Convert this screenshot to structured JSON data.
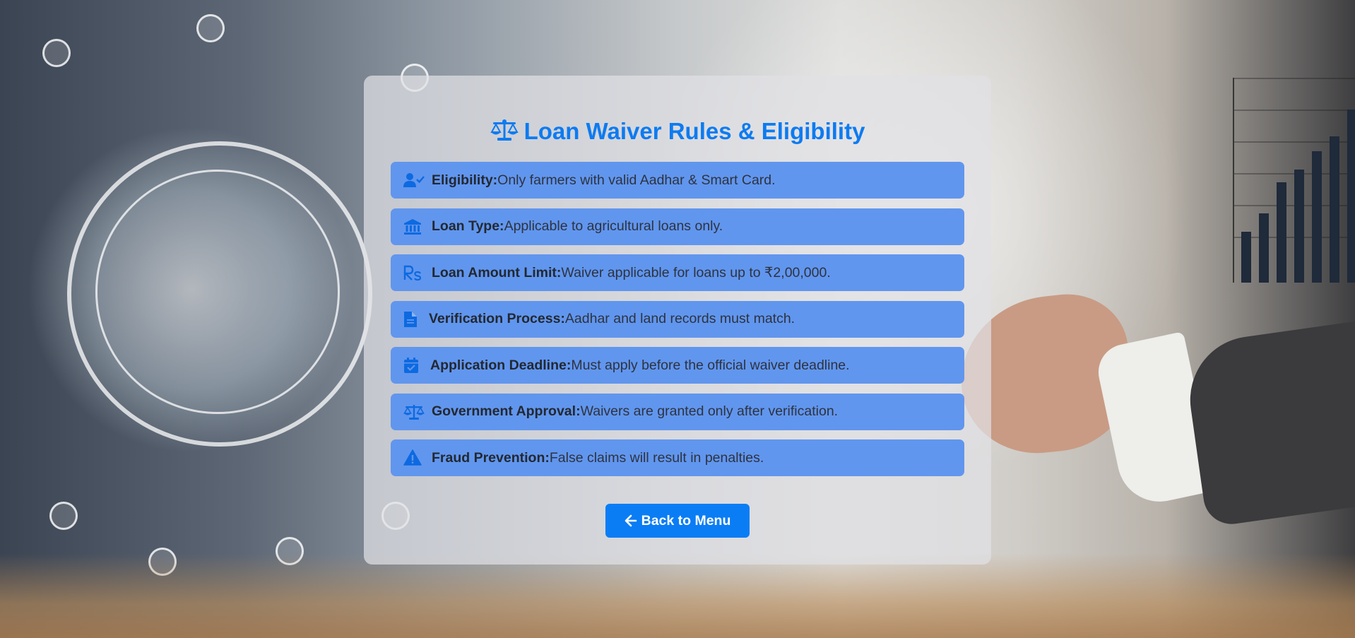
{
  "page": {
    "title": "Loan Waiver Rules & Eligibility",
    "title_icon": "scale-balance-icon"
  },
  "rules": [
    {
      "icon": "user-check-icon",
      "label": "Eligibility:",
      "text": "Only farmers with valid Aadhar & Smart Card."
    },
    {
      "icon": "bank-icon",
      "label": "Loan Type:",
      "text": "Applicable to agricultural loans only."
    },
    {
      "icon": "rupee-icon",
      "label": "Loan Amount Limit:",
      "text": "Waiver applicable for loans up to ₹2,00,000."
    },
    {
      "icon": "document-icon",
      "label": "Verification Process:",
      "text": "Aadhar and land records must match."
    },
    {
      "icon": "calendar-check-icon",
      "label": "Application Deadline:",
      "text": "Must apply before the official waiver deadline."
    },
    {
      "icon": "scale-balance-icon",
      "label": "Government Approval:",
      "text": "Waivers are granted only after verification."
    },
    {
      "icon": "warning-icon",
      "label": "Fraud Prevention:",
      "text": "False claims will result in penalties."
    }
  ],
  "back_button": {
    "label": "Back to Menu",
    "icon": "arrow-left-icon"
  },
  "colors": {
    "accent": "#0d7bf1",
    "item_bg": "#6196ee",
    "button_bg": "#0a7df5"
  }
}
